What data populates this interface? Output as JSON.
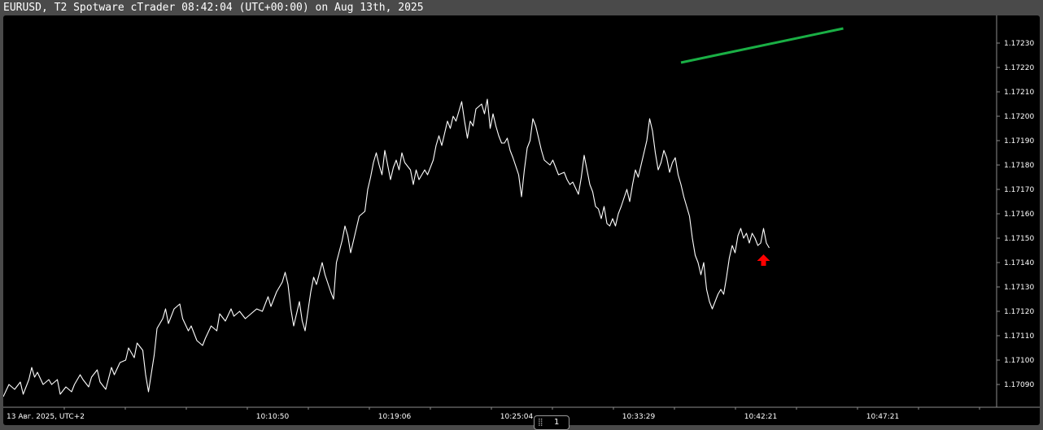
{
  "window": {
    "title": "EURUSD, T2 Spotware cTrader 08:42:04 (UTC+00:00) on Aug 13th, 2025"
  },
  "colors": {
    "background": "#000000",
    "frame": "#4a4a4a",
    "price_line": "#ffffff",
    "trend_line": "#1aaf45",
    "marker": "#ff0000"
  },
  "pager": {
    "page_number": "1"
  },
  "chart_data": {
    "type": "line",
    "symbol": "EURUSD",
    "x_axis": {
      "date_label": "13 Авг. 2025, UTC+2",
      "tick_labels": [
        "10:10:50",
        "10:19:06",
        "10:25:04",
        "10:33:29",
        "10:42:21",
        "10:47:21"
      ]
    },
    "y_axis": {
      "position": "right",
      "tick_labels": [
        "1.17230",
        "1.17220",
        "1.17210",
        "1.17200",
        "1.17190",
        "1.17180",
        "1.17170",
        "1.17160",
        "1.17150",
        "1.17140",
        "1.17130",
        "1.17120",
        "1.17110",
        "1.17100",
        "1.17090"
      ],
      "range": [
        1.17087,
        1.17235
      ]
    },
    "grid": false,
    "series": [
      {
        "type": "line",
        "points": [
          [
            0,
            1.17085
          ],
          [
            2,
            1.1709
          ],
          [
            4,
            1.17088
          ],
          [
            6,
            1.17091
          ],
          [
            7,
            1.17086
          ],
          [
            9,
            1.17092
          ],
          [
            10,
            1.17097
          ],
          [
            11,
            1.17093
          ],
          [
            12,
            1.17095
          ],
          [
            14,
            1.1709
          ],
          [
            16,
            1.17092
          ],
          [
            17,
            1.1709
          ],
          [
            19,
            1.17092
          ],
          [
            20,
            1.17086
          ],
          [
            22,
            1.17089
          ],
          [
            24,
            1.17087
          ],
          [
            25,
            1.1709
          ],
          [
            27,
            1.17094
          ],
          [
            28,
            1.17092
          ],
          [
            30,
            1.17089
          ],
          [
            31,
            1.17093
          ],
          [
            33,
            1.17096
          ],
          [
            34,
            1.17091
          ],
          [
            36,
            1.17088
          ],
          [
            38,
            1.17097
          ],
          [
            39,
            1.17094
          ],
          [
            41,
            1.17099
          ],
          [
            43,
            1.171
          ],
          [
            44,
            1.17105
          ],
          [
            46,
            1.17101
          ],
          [
            47,
            1.17107
          ],
          [
            49,
            1.17104
          ],
          [
            50,
            1.17094
          ],
          [
            51,
            1.17087
          ],
          [
            53,
            1.17102
          ],
          [
            54,
            1.17113
          ],
          [
            56,
            1.17117
          ],
          [
            57,
            1.17121
          ],
          [
            58,
            1.17115
          ],
          [
            60,
            1.17121
          ],
          [
            62,
            1.17123
          ],
          [
            63,
            1.17117
          ],
          [
            65,
            1.17112
          ],
          [
            66,
            1.17114
          ],
          [
            68,
            1.17108
          ],
          [
            70,
            1.17106
          ],
          [
            71,
            1.17109
          ],
          [
            73,
            1.17114
          ],
          [
            75,
            1.17112
          ],
          [
            76,
            1.17119
          ],
          [
            78,
            1.17116
          ],
          [
            80,
            1.17121
          ],
          [
            81,
            1.17118
          ],
          [
            83,
            1.1712
          ],
          [
            85,
            1.17117
          ],
          [
            87,
            1.17119
          ],
          [
            89,
            1.17121
          ],
          [
            91,
            1.1712
          ],
          [
            93,
            1.17126
          ],
          [
            94,
            1.17122
          ],
          [
            96,
            1.17128
          ],
          [
            98,
            1.17132
          ],
          [
            99,
            1.17136
          ],
          [
            100,
            1.17131
          ],
          [
            101,
            1.17121
          ],
          [
            102,
            1.17114
          ],
          [
            103,
            1.17119
          ],
          [
            104,
            1.17124
          ],
          [
            105,
            1.17116
          ],
          [
            106,
            1.17112
          ],
          [
            108,
            1.17128
          ],
          [
            109,
            1.17134
          ],
          [
            110,
            1.17131
          ],
          [
            112,
            1.1714
          ],
          [
            113,
            1.17135
          ],
          [
            115,
            1.17128
          ],
          [
            116,
            1.17125
          ],
          [
            117,
            1.1714
          ],
          [
            119,
            1.17149
          ],
          [
            120,
            1.17155
          ],
          [
            121,
            1.17151
          ],
          [
            122,
            1.17144
          ],
          [
            123,
            1.17149
          ],
          [
            124,
            1.17154
          ],
          [
            125,
            1.17159
          ],
          [
            127,
            1.17161
          ],
          [
            128,
            1.1717
          ],
          [
            129,
            1.17175
          ],
          [
            130,
            1.17181
          ],
          [
            131,
            1.17185
          ],
          [
            132,
            1.1718
          ],
          [
            133,
            1.17176
          ],
          [
            134,
            1.17186
          ],
          [
            136,
            1.17174
          ],
          [
            137,
            1.17179
          ],
          [
            138,
            1.17182
          ],
          [
            139,
            1.17178
          ],
          [
            140,
            1.17185
          ],
          [
            141,
            1.17181
          ],
          [
            143,
            1.17178
          ],
          [
            144,
            1.17172
          ],
          [
            145,
            1.17178
          ],
          [
            146,
            1.17174
          ],
          [
            148,
            1.17178
          ],
          [
            149,
            1.17176
          ],
          [
            151,
            1.17182
          ],
          [
            152,
            1.17188
          ],
          [
            153,
            1.17192
          ],
          [
            154,
            1.17188
          ],
          [
            156,
            1.17198
          ],
          [
            157,
            1.17195
          ],
          [
            158,
            1.172
          ],
          [
            159,
            1.17198
          ],
          [
            160,
            1.17202
          ],
          [
            161,
            1.17206
          ],
          [
            162,
            1.17198
          ],
          [
            163,
            1.17191
          ],
          [
            164,
            1.17198
          ],
          [
            165,
            1.17196
          ],
          [
            166,
            1.17203
          ],
          [
            168,
            1.17205
          ],
          [
            169,
            1.17201
          ],
          [
            170,
            1.17207
          ],
          [
            171,
            1.17195
          ],
          [
            172,
            1.17201
          ],
          [
            173,
            1.17196
          ],
          [
            174,
            1.17192
          ],
          [
            175,
            1.17189
          ],
          [
            176,
            1.17189
          ],
          [
            177,
            1.17191
          ],
          [
            178,
            1.17186
          ],
          [
            179,
            1.17183
          ],
          [
            181,
            1.17176
          ],
          [
            182,
            1.17167
          ],
          [
            183,
            1.17178
          ],
          [
            184,
            1.17187
          ],
          [
            185,
            1.1719
          ],
          [
            186,
            1.17199
          ],
          [
            187,
            1.17196
          ],
          [
            189,
            1.17186
          ],
          [
            190,
            1.17182
          ],
          [
            192,
            1.1718
          ],
          [
            193,
            1.17182
          ],
          [
            195,
            1.17176
          ],
          [
            197,
            1.17177
          ],
          [
            198,
            1.17174
          ],
          [
            199,
            1.17172
          ],
          [
            200,
            1.17173
          ],
          [
            202,
            1.17168
          ],
          [
            203,
            1.17175
          ],
          [
            204,
            1.17184
          ],
          [
            205,
            1.17178
          ],
          [
            206,
            1.17172
          ],
          [
            207,
            1.17169
          ],
          [
            208,
            1.17163
          ],
          [
            209,
            1.17162
          ],
          [
            210,
            1.17158
          ],
          [
            211,
            1.17163
          ],
          [
            212,
            1.17156
          ],
          [
            213,
            1.17155
          ],
          [
            214,
            1.17158
          ],
          [
            215,
            1.17155
          ],
          [
            216,
            1.1716
          ],
          [
            217,
            1.17163
          ],
          [
            219,
            1.1717
          ],
          [
            220,
            1.17165
          ],
          [
            221,
            1.17172
          ],
          [
            222,
            1.17178
          ],
          [
            223,
            1.17175
          ],
          [
            224,
            1.1718
          ],
          [
            225,
            1.17185
          ],
          [
            226,
            1.1719
          ],
          [
            227,
            1.17199
          ],
          [
            228,
            1.17194
          ],
          [
            229,
            1.17185
          ],
          [
            230,
            1.17178
          ],
          [
            231,
            1.17181
          ],
          [
            232,
            1.17186
          ],
          [
            233,
            1.17183
          ],
          [
            234,
            1.17177
          ],
          [
            235,
            1.17181
          ],
          [
            236,
            1.17183
          ],
          [
            237,
            1.17176
          ],
          [
            238,
            1.17172
          ],
          [
            239,
            1.17167
          ],
          [
            240,
            1.17163
          ],
          [
            241,
            1.17159
          ],
          [
            242,
            1.1715
          ],
          [
            243,
            1.17143
          ],
          [
            244,
            1.1714
          ],
          [
            245,
            1.17135
          ],
          [
            246,
            1.1714
          ],
          [
            247,
            1.17129
          ],
          [
            248,
            1.17124
          ],
          [
            249,
            1.17121
          ],
          [
            250,
            1.17124
          ],
          [
            251,
            1.17127
          ],
          [
            252,
            1.17129
          ],
          [
            253,
            1.17127
          ],
          [
            254,
            1.17134
          ],
          [
            255,
            1.17142
          ],
          [
            256,
            1.17147
          ],
          [
            257,
            1.17144
          ],
          [
            258,
            1.17151
          ],
          [
            259,
            1.17154
          ],
          [
            260,
            1.1715
          ],
          [
            261,
            1.17152
          ],
          [
            262,
            1.17148
          ],
          [
            263,
            1.17152
          ],
          [
            264,
            1.1715
          ],
          [
            265,
            1.17147
          ],
          [
            266,
            1.17148
          ],
          [
            267,
            1.17154
          ],
          [
            268,
            1.17148
          ],
          [
            269,
            1.17146
          ]
        ]
      },
      {
        "type": "trendline",
        "points": [
          [
            238,
            1.17222
          ],
          [
            295,
            1.17236
          ]
        ]
      }
    ],
    "annotations": [
      {
        "type": "arrow-up",
        "x": 267,
        "y": 1.17142
      }
    ]
  }
}
